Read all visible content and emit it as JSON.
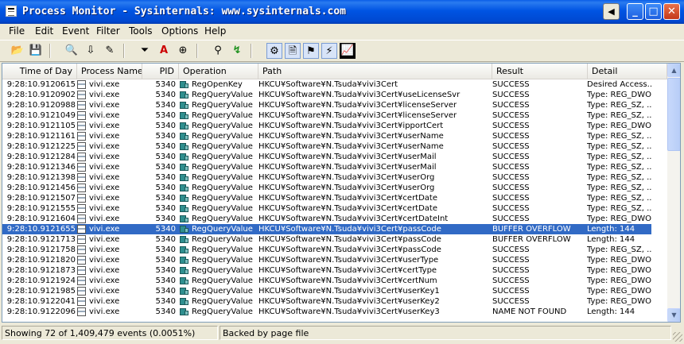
{
  "window": {
    "title": "Process Monitor - Sysinternals: www.sysinternals.com",
    "back_glyph": "◀",
    "min_glyph": "_",
    "max_glyph": "□",
    "close_glyph": "✕"
  },
  "menu": [
    "File",
    "Edit",
    "Event",
    "Filter",
    "Tools",
    "Options",
    "Help"
  ],
  "toolbar": {
    "open_icon": "📂",
    "save_icon": "💾",
    "find_icon": "🔍",
    "autoscroll_icon": "⇩",
    "clear_icon": "✎",
    "filter_icon": "⏷",
    "highlight_icon": "A",
    "target_icon": "⊕",
    "jump_icon": "⚲",
    "goto_icon": "↯",
    "registry_icon": "⚙",
    "filesystem_icon": "🗎",
    "network_icon": "⚑",
    "process_icon": "⚡",
    "profiling_icon": "📈"
  },
  "columns": {
    "time": "Time of Day",
    "process": "Process Name",
    "pid": "PID",
    "operation": "Operation",
    "path": "Path",
    "result": "Result",
    "detail": "Detail"
  },
  "rows": [
    {
      "time": "9:28:10.9120615",
      "proc": "vivi.exe",
      "pid": "5340",
      "op": "RegOpenKey",
      "path": "HKCU¥Software¥N.Tsuda¥vivi3Cert",
      "result": "SUCCESS",
      "detail": "Desired Access..."
    },
    {
      "time": "9:28:10.9120902",
      "proc": "vivi.exe",
      "pid": "5340",
      "op": "RegQueryValue",
      "path": "HKCU¥Software¥N.Tsuda¥vivi3Cert¥useLicenseSvr",
      "result": "SUCCESS",
      "detail": "Type: REG_DWO..."
    },
    {
      "time": "9:28:10.9120988",
      "proc": "vivi.exe",
      "pid": "5340",
      "op": "RegQueryValue",
      "path": "HKCU¥Software¥N.Tsuda¥vivi3Cert¥licenseServer",
      "result": "SUCCESS",
      "detail": "Type: REG_SZ, ..."
    },
    {
      "time": "9:28:10.9121049",
      "proc": "vivi.exe",
      "pid": "5340",
      "op": "RegQueryValue",
      "path": "HKCU¥Software¥N.Tsuda¥vivi3Cert¥licenseServer",
      "result": "SUCCESS",
      "detail": "Type: REG_SZ, ..."
    },
    {
      "time": "9:28:10.9121105",
      "proc": "vivi.exe",
      "pid": "5340",
      "op": "RegQueryValue",
      "path": "HKCU¥Software¥N.Tsuda¥vivi3Cert¥ipportCert",
      "result": "SUCCESS",
      "detail": "Type: REG_DWO..."
    },
    {
      "time": "9:28:10.9121161",
      "proc": "vivi.exe",
      "pid": "5340",
      "op": "RegQueryValue",
      "path": "HKCU¥Software¥N.Tsuda¥vivi3Cert¥userName",
      "result": "SUCCESS",
      "detail": "Type: REG_SZ, ..."
    },
    {
      "time": "9:28:10.9121225",
      "proc": "vivi.exe",
      "pid": "5340",
      "op": "RegQueryValue",
      "path": "HKCU¥Software¥N.Tsuda¥vivi3Cert¥userName",
      "result": "SUCCESS",
      "detail": "Type: REG_SZ, ..."
    },
    {
      "time": "9:28:10.9121284",
      "proc": "vivi.exe",
      "pid": "5340",
      "op": "RegQueryValue",
      "path": "HKCU¥Software¥N.Tsuda¥vivi3Cert¥userMail",
      "result": "SUCCESS",
      "detail": "Type: REG_SZ, ..."
    },
    {
      "time": "9:28:10.9121346",
      "proc": "vivi.exe",
      "pid": "5340",
      "op": "RegQueryValue",
      "path": "HKCU¥Software¥N.Tsuda¥vivi3Cert¥userMail",
      "result": "SUCCESS",
      "detail": "Type: REG_SZ, ..."
    },
    {
      "time": "9:28:10.9121398",
      "proc": "vivi.exe",
      "pid": "5340",
      "op": "RegQueryValue",
      "path": "HKCU¥Software¥N.Tsuda¥vivi3Cert¥userOrg",
      "result": "SUCCESS",
      "detail": "Type: REG_SZ, ..."
    },
    {
      "time": "9:28:10.9121456",
      "proc": "vivi.exe",
      "pid": "5340",
      "op": "RegQueryValue",
      "path": "HKCU¥Software¥N.Tsuda¥vivi3Cert¥userOrg",
      "result": "SUCCESS",
      "detail": "Type: REG_SZ, ..."
    },
    {
      "time": "9:28:10.9121507",
      "proc": "vivi.exe",
      "pid": "5340",
      "op": "RegQueryValue",
      "path": "HKCU¥Software¥N.Tsuda¥vivi3Cert¥certDate",
      "result": "SUCCESS",
      "detail": "Type: REG_SZ, ..."
    },
    {
      "time": "9:28:10.9121555",
      "proc": "vivi.exe",
      "pid": "5340",
      "op": "RegQueryValue",
      "path": "HKCU¥Software¥N.Tsuda¥vivi3Cert¥certDate",
      "result": "SUCCESS",
      "detail": "Type: REG_SZ, ..."
    },
    {
      "time": "9:28:10.9121604",
      "proc": "vivi.exe",
      "pid": "5340",
      "op": "RegQueryValue",
      "path": "HKCU¥Software¥N.Tsuda¥vivi3Cert¥certDateInt",
      "result": "SUCCESS",
      "detail": "Type: REG_DWO..."
    },
    {
      "time": "9:28:10.9121655",
      "proc": "vivi.exe",
      "pid": "5340",
      "op": "RegQueryValue",
      "path": "HKCU¥Software¥N.Tsuda¥vivi3Cert¥passCode",
      "result": "BUFFER OVERFLOW",
      "detail": "Length: 144",
      "selected": true
    },
    {
      "time": "9:28:10.9121713",
      "proc": "vivi.exe",
      "pid": "5340",
      "op": "RegQueryValue",
      "path": "HKCU¥Software¥N.Tsuda¥vivi3Cert¥passCode",
      "result": "BUFFER OVERFLOW",
      "detail": "Length: 144"
    },
    {
      "time": "9:28:10.9121758",
      "proc": "vivi.exe",
      "pid": "5340",
      "op": "RegQueryValue",
      "path": "HKCU¥Software¥N.Tsuda¥vivi3Cert¥passCode",
      "result": "SUCCESS",
      "detail": "Type: REG_SZ, ..."
    },
    {
      "time": "9:28:10.9121820",
      "proc": "vivi.exe",
      "pid": "5340",
      "op": "RegQueryValue",
      "path": "HKCU¥Software¥N.Tsuda¥vivi3Cert¥userType",
      "result": "SUCCESS",
      "detail": "Type: REG_DWO..."
    },
    {
      "time": "9:28:10.9121873",
      "proc": "vivi.exe",
      "pid": "5340",
      "op": "RegQueryValue",
      "path": "HKCU¥Software¥N.Tsuda¥vivi3Cert¥certType",
      "result": "SUCCESS",
      "detail": "Type: REG_DWO..."
    },
    {
      "time": "9:28:10.9121924",
      "proc": "vivi.exe",
      "pid": "5340",
      "op": "RegQueryValue",
      "path": "HKCU¥Software¥N.Tsuda¥vivi3Cert¥certNum",
      "result": "SUCCESS",
      "detail": "Type: REG_DWO..."
    },
    {
      "time": "9:28:10.9121985",
      "proc": "vivi.exe",
      "pid": "5340",
      "op": "RegQueryValue",
      "path": "HKCU¥Software¥N.Tsuda¥vivi3Cert¥userKey1",
      "result": "SUCCESS",
      "detail": "Type: REG_DWO..."
    },
    {
      "time": "9:28:10.9122041",
      "proc": "vivi.exe",
      "pid": "5340",
      "op": "RegQueryValue",
      "path": "HKCU¥Software¥N.Tsuda¥vivi3Cert¥userKey2",
      "result": "SUCCESS",
      "detail": "Type: REG_DWO..."
    },
    {
      "time": "9:28:10.9122096",
      "proc": "vivi.exe",
      "pid": "5340",
      "op": "RegQueryValue",
      "path": "HKCU¥Software¥N.Tsuda¥vivi3Cert¥userKey3",
      "result": "NAME NOT FOUND",
      "detail": "Length: 144"
    }
  ],
  "status": {
    "events": "Showing 72 of 1,409,479 events (0.0051%)",
    "backing": "Backed by page file"
  },
  "colors": {
    "selection": "#316ac5",
    "titlebar": "#0054e3"
  }
}
